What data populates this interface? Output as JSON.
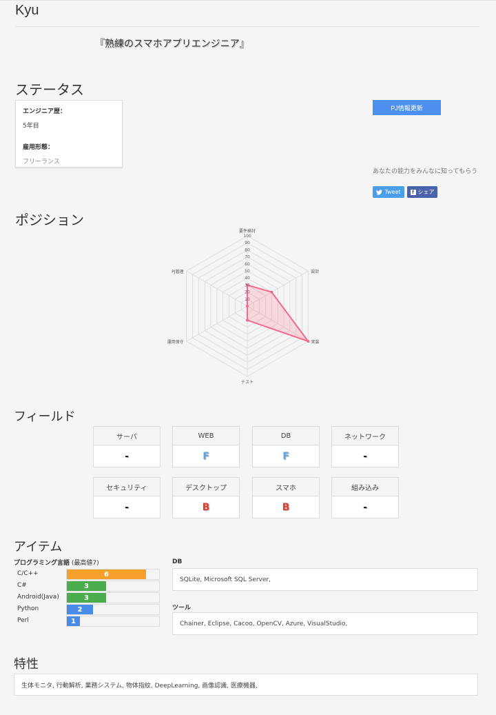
{
  "profile": {
    "name": "Kyu",
    "tagline": "『熟練のスマホアプリエンジニア』"
  },
  "status": {
    "title": "ステータス",
    "experience_label": "エンジニア歴：",
    "experience_value": "5年目",
    "employment_label": "雇用形態：",
    "employment_value": "フリーランス",
    "update_button": "PJ情報更新",
    "share_text": "あなたの能力をみんなに知ってもらう",
    "tweet_label": "Tweet",
    "fb_label": "シェア"
  },
  "position": {
    "title": "ポジション",
    "chart_data": {
      "type": "radar",
      "axes": [
        "要件検討",
        "設計",
        "実装",
        "テスト",
        "運用保守",
        "PJ管理"
      ],
      "values": [
        30,
        40,
        100,
        20,
        0,
        0
      ],
      "range": [
        0,
        100
      ],
      "ticks": [
        10,
        20,
        30,
        40,
        50,
        60,
        70,
        80,
        90,
        100
      ],
      "fill_color": "rgba(255,99,132,0.2)",
      "line_color": "#f06b8a"
    }
  },
  "field": {
    "title": "フィールド",
    "items": [
      {
        "name": "サーバ",
        "grade": "-",
        "color": "#222222"
      },
      {
        "name": "WEB",
        "grade": "F",
        "color": "#5aa6e6"
      },
      {
        "name": "DB",
        "grade": "F",
        "color": "#5aa6e6"
      },
      {
        "name": "ネットワーク",
        "grade": "-",
        "color": "#222222"
      },
      {
        "name": "セキュリティ",
        "grade": "-",
        "color": "#222222"
      },
      {
        "name": "デスクトップ",
        "grade": "B",
        "color": "#d9412f"
      },
      {
        "name": "スマホ",
        "grade": "B",
        "color": "#d9412f"
      },
      {
        "name": "組み込み",
        "grade": "-",
        "color": "#222222"
      }
    ]
  },
  "items": {
    "title": "アイテム",
    "lang_title": "プログラミング言語",
    "lang_note": "(最高値7)",
    "lang_max": 7,
    "languages": [
      {
        "name": "C/C++",
        "level": 6,
        "color": "#f5a02a"
      },
      {
        "name": "C#",
        "level": 3,
        "color": "#4cad4e"
      },
      {
        "name": "Android(Java)",
        "level": 3,
        "color": "#4cad4e"
      },
      {
        "name": "Python",
        "level": 2,
        "color": "#4a8be8"
      },
      {
        "name": "Perl",
        "level": 1,
        "color": "#4a8be8"
      }
    ],
    "db_label": "DB",
    "db_value": "SQLite, Microsoft SQL Server,",
    "tool_label": "ツール",
    "tool_value": "Chainer, Eclipse, Cacoo, OpenCV, Azure, VisualStudio,"
  },
  "traits": {
    "title": "特性",
    "value": "生体モニタ, 行動解析, 業務システム, 物体指紋, DeepLearning, 画像認識, 医療機器,"
  }
}
